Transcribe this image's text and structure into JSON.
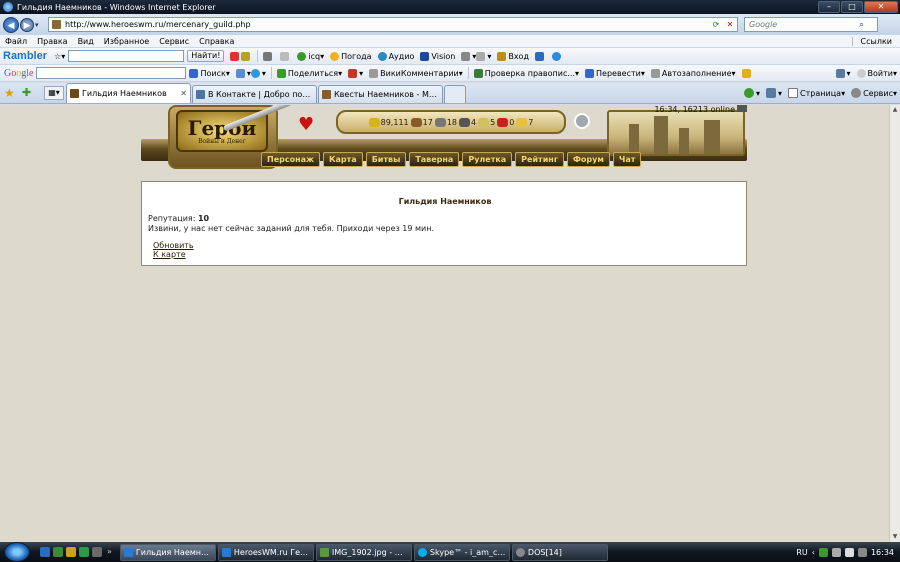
{
  "window": {
    "title": "Гильдия Наемников - Windows Internet Explorer",
    "buttons": {
      "minimize": "–",
      "maximize": "□",
      "close": "✕"
    }
  },
  "address": {
    "url": "http://www.heroeswm.ru/mercenary_guild.php",
    "search_placeholder": "Google"
  },
  "menu": {
    "items": [
      "Файл",
      "Правка",
      "Вид",
      "Избранное",
      "Сервис",
      "Справка"
    ],
    "links": "Ссылки"
  },
  "rambler_toolbar": {
    "logo": "Rambler",
    "find": "Найти!",
    "icq": "icq",
    "weather": "Погода",
    "audio": "Аудио",
    "vision": "Vision",
    "login": "Вход"
  },
  "google_toolbar": {
    "logo": "Google",
    "search": "Поиск",
    "share": "Поделиться",
    "wiki": "ВикиКомментарии",
    "spell": "Проверка правопис...",
    "translate": "Перевести",
    "autofill": "Автозаполнение",
    "signin": "Войти"
  },
  "tabs": [
    {
      "label": "Гильдия Наемников",
      "color": "#6b4a1a",
      "active": true
    },
    {
      "label": "В Контакте | Добро пожа...",
      "color": "#4c75a3",
      "active": false
    },
    {
      "label": "Квесты Наемников - Мол...",
      "color": "#8a5a2a",
      "active": false
    }
  ],
  "command_bar": {
    "page": "Страница",
    "service": "Сервис"
  },
  "game": {
    "logo_main": "Герои",
    "logo_sub": "Войны и Денег",
    "resources": [
      {
        "value": "89,111",
        "color": "#d7b21a"
      },
      {
        "value": "17",
        "color": "#8a5a2a"
      },
      {
        "value": "18",
        "color": "#777777"
      },
      {
        "value": "4",
        "color": "#555555"
      },
      {
        "value": "5",
        "color": "#d0c060"
      },
      {
        "value": "0",
        "color": "#cc2020"
      },
      {
        "value": "7",
        "color": "#e8c040"
      }
    ],
    "online": "16:34, 16213 online",
    "nav": [
      "Персонаж",
      "Карта",
      "Битвы",
      "Таверна",
      "Рулетка",
      "Рейтинг",
      "Форум",
      "Чат"
    ]
  },
  "panel": {
    "title": "Гильдия Наемников",
    "reputation_label": "Репутация:",
    "reputation_value": "10",
    "message": "Извини, у нас нет сейчас заданий для тебя. Приходи через 19 мин.",
    "refresh_link": "Обновить",
    "map_link": "К карте"
  },
  "taskbar": {
    "items": [
      {
        "label": "Гильдия Наемнико...",
        "color": "#2a7ad0",
        "active": true
      },
      {
        "label": "HeroesWM.ru Геро...",
        "color": "#2a7ad0",
        "active": false
      },
      {
        "label": "IMG_1902.jpg - Фот...",
        "color": "#5a9a3a",
        "active": false
      },
      {
        "label": "Skype™ - i_am_child",
        "color": "#00aff0",
        "active": false
      },
      {
        "label": "DOS[14]",
        "color": "#888888",
        "active": false
      }
    ],
    "more": "»",
    "lang": "RU",
    "clock": "16:34"
  }
}
